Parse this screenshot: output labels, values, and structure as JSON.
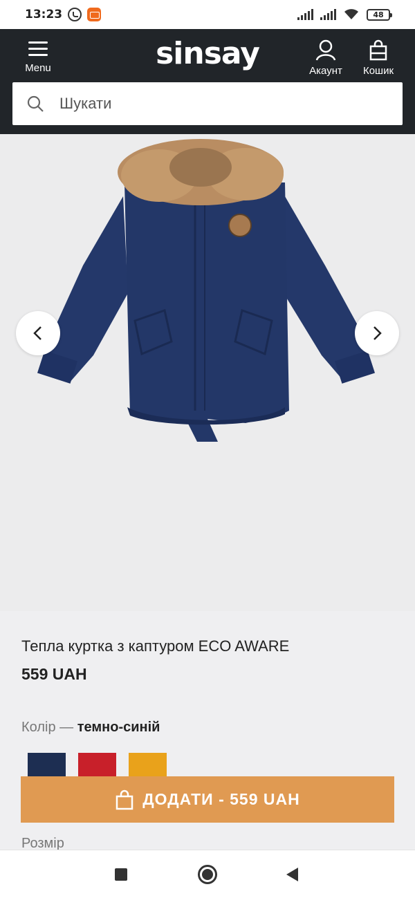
{
  "status_bar": {
    "time": "13:23",
    "battery": "48"
  },
  "header": {
    "menu_label": "Menu",
    "logo": "sinsay",
    "account_label": "Акаунт",
    "cart_label": "Кошик",
    "search_placeholder": "Шукати"
  },
  "product": {
    "title": "Тепла куртка з каптуром ECO AWARE",
    "price": "559 UAH",
    "color_label": "Колір —",
    "color_value": "темно-синій",
    "colors": [
      "#1d2e52",
      "#c8202a",
      "#e9a21b"
    ],
    "add_button_label": "ДОДАТИ - 559 UAH",
    "size_label": "Розмір"
  },
  "icons": {
    "menu": "hamburger-icon",
    "account": "user-icon",
    "cart": "shopping-bag-icon",
    "search": "search-icon",
    "prev": "chevron-left-icon",
    "next": "chevron-right-icon",
    "add": "shopping-bag-icon"
  }
}
